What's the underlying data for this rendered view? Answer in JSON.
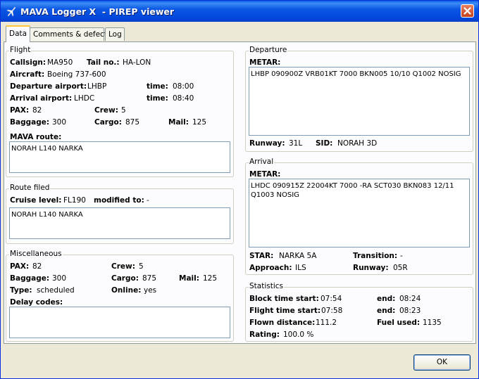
{
  "window": {
    "title": "MAVA Logger X  - PIREP viewer"
  },
  "tabs": [
    {
      "label": "Data"
    },
    {
      "label": "Comments & defects"
    },
    {
      "label": "Log"
    }
  ],
  "flight": {
    "group_title": "Flight",
    "callsign_label": "Callsign:",
    "callsign": "MA950",
    "tail_label": "Tail no.:",
    "tail": "HA-LON",
    "aircraft_label": "Aircraft:",
    "aircraft": "Boeing 737-600",
    "dep_airport_label": "Departure airport:",
    "dep_airport": "LHBP",
    "dep_time_label": "time:",
    "dep_time": "08:00",
    "arr_airport_label": "Arrival airport:",
    "arr_airport": "LHDC",
    "arr_time_label": "time:",
    "arr_time": "08:40",
    "pax_label": "PAX:",
    "pax": "82",
    "crew_label": "Crew:",
    "crew": "5",
    "baggage_label": "Baggage:",
    "baggage": "300",
    "cargo_label": "Cargo:",
    "cargo": "875",
    "mail_label": "Mail:",
    "mail": "125",
    "route_label": "MAVA route:",
    "route": "NORAH L140 NARKA"
  },
  "route_filed": {
    "group_title": "Route filed",
    "cruise_label": "Cruise level:",
    "cruise": "FL190",
    "modified_label": "modified to:",
    "modified": "-",
    "route": "NORAH L140 NARKA"
  },
  "misc": {
    "group_title": "Miscellaneous",
    "pax_label": "PAX:",
    "pax": "82",
    "crew_label": "Crew:",
    "crew": "5",
    "baggage_label": "Baggage:",
    "baggage": "300",
    "cargo_label": "Cargo:",
    "cargo": "875",
    "mail_label": "Mail:",
    "mail": "125",
    "type_label": "Type:",
    "type": "scheduled",
    "online_label": "Online:",
    "online": "yes",
    "delay_label": "Delay codes:",
    "delay": ""
  },
  "departure": {
    "group_title": "Departure",
    "metar_label": "METAR:",
    "metar": "LHBP 090900Z VRB01KT 7000 BKN005 10/10 Q1002 NOSIG",
    "runway_label": "Runway:",
    "runway": "31L",
    "sid_label": "SID:",
    "sid": "NORAH 3D"
  },
  "arrival": {
    "group_title": "Arrival",
    "metar_label": "METAR:",
    "metar": "LHDC 090915Z 22004KT 7000 -RA SCT030 BKN083 12/11 Q1003 NOSIG",
    "star_label": "STAR:",
    "star": "NARKA 5A",
    "transition_label": "Transition:",
    "transition": "-",
    "approach_label": "Approach:",
    "approach": "ILS",
    "runway_label": "Runway:",
    "runway": "05R"
  },
  "statistics": {
    "group_title": "Statistics",
    "block_start_label": "Block time start:",
    "block_start": "07:54",
    "block_end_label": "end:",
    "block_end": "08:24",
    "flight_start_label": "Flight time start:",
    "flight_start": "07:58",
    "flight_end_label": "end:",
    "flight_end": "08:23",
    "distance_label": "Flown distance:",
    "distance": "111.2",
    "fuel_label": "Fuel used:",
    "fuel": "1135",
    "rating_label": "Rating:",
    "rating": "100.0 %"
  },
  "buttons": {
    "ok": "OK"
  }
}
